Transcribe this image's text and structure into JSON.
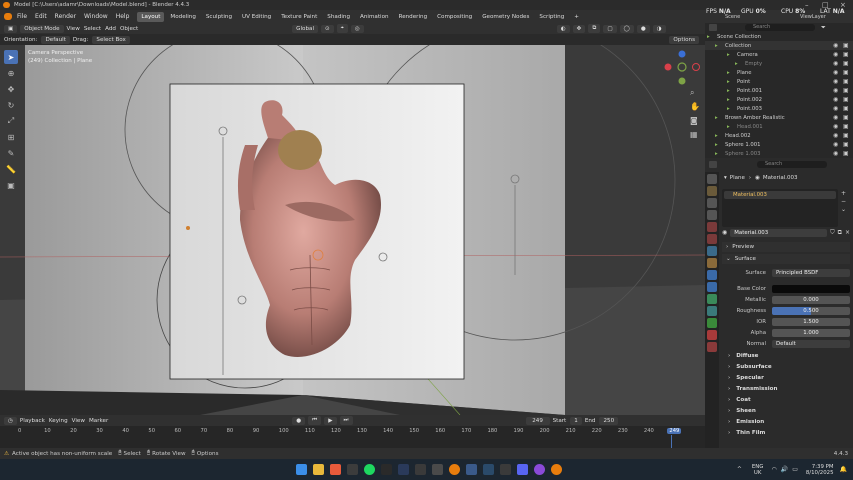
{
  "window": {
    "title": "Model [C:\\Users\\adamr\\Downloads\\Model.blend] - Blender 4.4.3"
  },
  "menu": [
    "File",
    "Edit",
    "Render",
    "Window",
    "Help"
  ],
  "workspaces": [
    "Layout",
    "Modeling",
    "Sculpting",
    "UV Editing",
    "Texture Paint",
    "Shading",
    "Animation",
    "Rendering",
    "Compositing",
    "Geometry Nodes",
    "Scripting"
  ],
  "hud": {
    "fps_label": "FPS",
    "fps": "N/A",
    "gpu_label": "GPU",
    "gpu": "0%",
    "cpu_label": "CPU",
    "cpu": "8%",
    "lat_label": "LAT",
    "lat": "N/A",
    "scene": "Scene",
    "view_layer": "ViewLayer"
  },
  "viewport_header": {
    "mode": "Object Mode",
    "view": "View",
    "select": "Select",
    "add": "Add",
    "object": "Object",
    "transform": "Global",
    "orientation_label": "Orientation:",
    "orientation": "Default",
    "drag_label": "Drag:",
    "drag": "Select Box",
    "options": "Options"
  },
  "viewport": {
    "camera_text": "Camera Perspective",
    "object_text": "(249) Collection | Plane"
  },
  "outliner": {
    "search_placeholder": "Search",
    "rows": [
      {
        "name": "Scene Collection",
        "indent": 2,
        "dim": false
      },
      {
        "name": "Collection",
        "indent": 10,
        "dim": false
      },
      {
        "name": "Camera",
        "indent": 22,
        "dim": false
      },
      {
        "name": "Empty",
        "indent": 30,
        "dim": true
      },
      {
        "name": "Plane",
        "indent": 22,
        "dim": false
      },
      {
        "name": "Point",
        "indent": 22,
        "dim": false
      },
      {
        "name": "Point.001",
        "indent": 22,
        "dim": false
      },
      {
        "name": "Point.002",
        "indent": 22,
        "dim": false
      },
      {
        "name": "Point.003",
        "indent": 22,
        "dim": false
      },
      {
        "name": "Brown Amber Realistic",
        "indent": 10,
        "dim": false
      },
      {
        "name": "Head.001",
        "indent": 22,
        "dim": true
      },
      {
        "name": "Head.002",
        "indent": 10,
        "dim": false
      },
      {
        "name": "Sphere 1.001",
        "indent": 10,
        "dim": false
      },
      {
        "name": "Sphere 1.003",
        "indent": 10,
        "dim": true
      }
    ]
  },
  "properties": {
    "search_placeholder": "Search",
    "breadcrumb_object": "Plane",
    "breadcrumb_material": "Material.003",
    "slot": "Material.003",
    "material": "Material.003",
    "preview": "Preview",
    "surface": "Surface",
    "surface_label": "Surface",
    "surface_value": "Principled BSDF",
    "fields": [
      {
        "k": "Base Color",
        "v": ""
      },
      {
        "k": "Metallic",
        "v": "0.000"
      },
      {
        "k": "Roughness",
        "v": "0.500"
      },
      {
        "k": "IOR",
        "v": "1.500"
      },
      {
        "k": "Alpha",
        "v": "1.000"
      },
      {
        "k": "Normal",
        "v": "Default"
      }
    ],
    "sections": [
      "Diffuse",
      "Subsurface",
      "Specular",
      "Transmission",
      "Coat",
      "Sheen",
      "Emission",
      "Thin Film"
    ],
    "colors": {
      "base_color": "#0a0a0a",
      "accent": "#4a72b5"
    }
  },
  "timeline": {
    "playback": "Playback",
    "keying": "Keying",
    "view": "View",
    "marker": "Marker",
    "current": "249",
    "start_label": "Start",
    "start": "1",
    "end_label": "End",
    "end": "250",
    "ticks": [
      "0",
      "10",
      "20",
      "30",
      "40",
      "50",
      "60",
      "70",
      "80",
      "90",
      "100",
      "110",
      "120",
      "130",
      "140",
      "150",
      "160",
      "170",
      "180",
      "190",
      "200",
      "210",
      "220",
      "230",
      "240",
      "249"
    ]
  },
  "statusbar": {
    "message": "Active object has non-uniform scale",
    "select": "Select",
    "rotate": "Rotate View",
    "options": "Options",
    "version": "4.4.3"
  },
  "taskbar": {
    "lang": "ENG",
    "region": "UK",
    "time": "7:39 PM",
    "date": "8/10/2025"
  }
}
